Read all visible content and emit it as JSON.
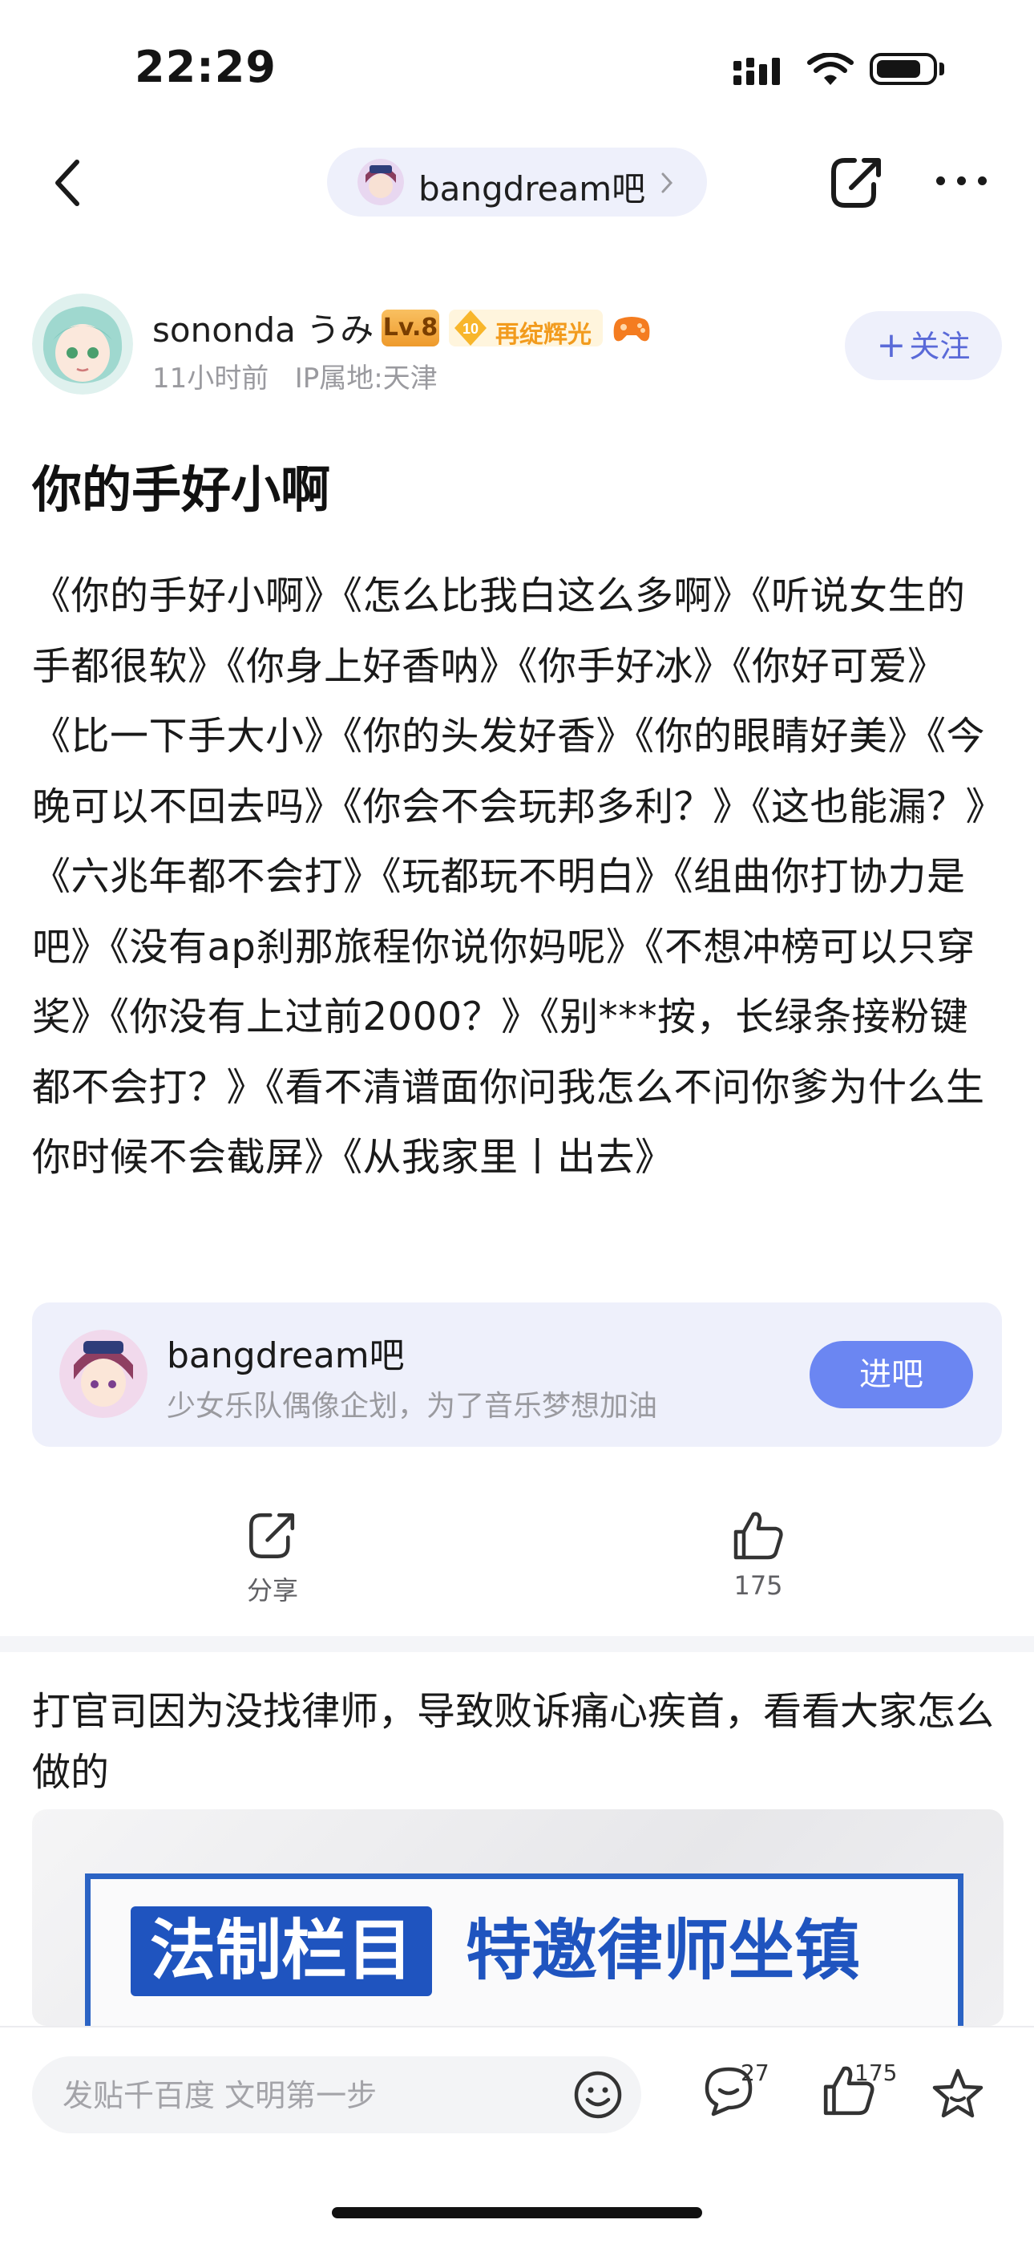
{
  "status_bar": {
    "time": "22:29"
  },
  "nav": {
    "forum_name": "bangdream吧"
  },
  "author": {
    "name": "sononda うみ",
    "level": "Lv.8",
    "honor_level": "10",
    "honor_title": "再绽辉光",
    "time_ago": "11小时前",
    "ip_location": "IP属地:天津",
    "follow_label": "关注"
  },
  "post": {
    "title": "你的手好小啊",
    "body": "《你的手好小啊》《怎么比我白这么多啊》《听说女生的手都很软》《你身上好香呐》《你手好冰》《你好可爱》《比一下手大小》《你的头发好香》《你的眼睛好美》《今晚可以不回去吗》《你会不会玩邦多利？》《这也能漏？》《六兆年都不会打》《玩都玩不明白》《组曲你打协力是吧》《没有ap刹那旅程你说你妈呢》《不想冲榜可以只穿奖》《你没有上过前2000？》《别***按，长绿条接粉键都不会打？》《看不清谱面你问我怎么不问你爹为什么生你时候不会截屏》《从我家里丨出去》"
  },
  "forum_card": {
    "name": "bangdream吧",
    "description": "少女乐队偶像企划，为了音乐梦想加油",
    "enter_label": "进吧"
  },
  "actions": {
    "share_label": "分享",
    "like_count": "175"
  },
  "ad": {
    "text": "打官司因为没找律师，导致败诉痛心疾首，看看大家怎么做的",
    "image_tag": "法制栏目",
    "image_headline": "特邀律师坐镇"
  },
  "bottom_bar": {
    "input_placeholder": "发贴千百度 文明第一步",
    "comment_count": "27",
    "like_count": "175"
  },
  "colors": {
    "accent": "#6b86f2",
    "pill_bg": "#eef0fb",
    "follow_text": "#5a6ad8"
  }
}
